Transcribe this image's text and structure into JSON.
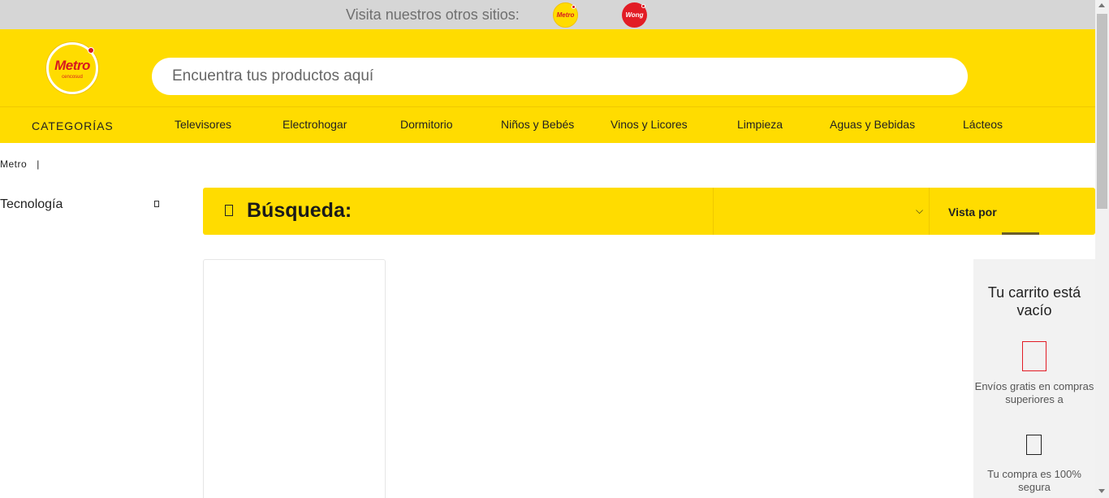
{
  "topbar": {
    "text": "Visita nuestros otros sitios:",
    "sites": [
      {
        "name": "Metro",
        "logo_text": "Metro",
        "color": "#ffdc00"
      },
      {
        "name": "Wong",
        "logo_text": "Wong",
        "color": "#e21c25"
      }
    ]
  },
  "header": {
    "logo_text": "Metro",
    "logo_subtext": "cencosud",
    "search_placeholder": "Encuentra tus productos aquí",
    "brand_color": "#ffdc00",
    "accent_color": "#d71920"
  },
  "nav": {
    "categories_label": "CATEGORÍAS",
    "items": [
      "Televisores",
      "Electrohogar",
      "Dormitorio",
      "Niños y Bebés",
      "Vinos y Licores",
      "Limpieza",
      "Aguas y Bebidas",
      "Lácteos"
    ]
  },
  "breadcrumb": {
    "home": "Metro",
    "separator": "|"
  },
  "sidebar": {
    "title": "Tecnología",
    "toggle_icon": "collapse-icon"
  },
  "results": {
    "title": "Búsqueda:",
    "filter_icon": "filter-icon",
    "sort_value": "",
    "sort_icon": "chevron-down-icon",
    "view_label": "Vista por"
  },
  "cart": {
    "title": "Tu carrito está vacío",
    "shipping_text": "Envíos gratis en compras superiores a",
    "secure_text": "Tu compra es 100% segura",
    "shipping_icon": "truck-icon",
    "secure_icon": "lock-icon"
  }
}
